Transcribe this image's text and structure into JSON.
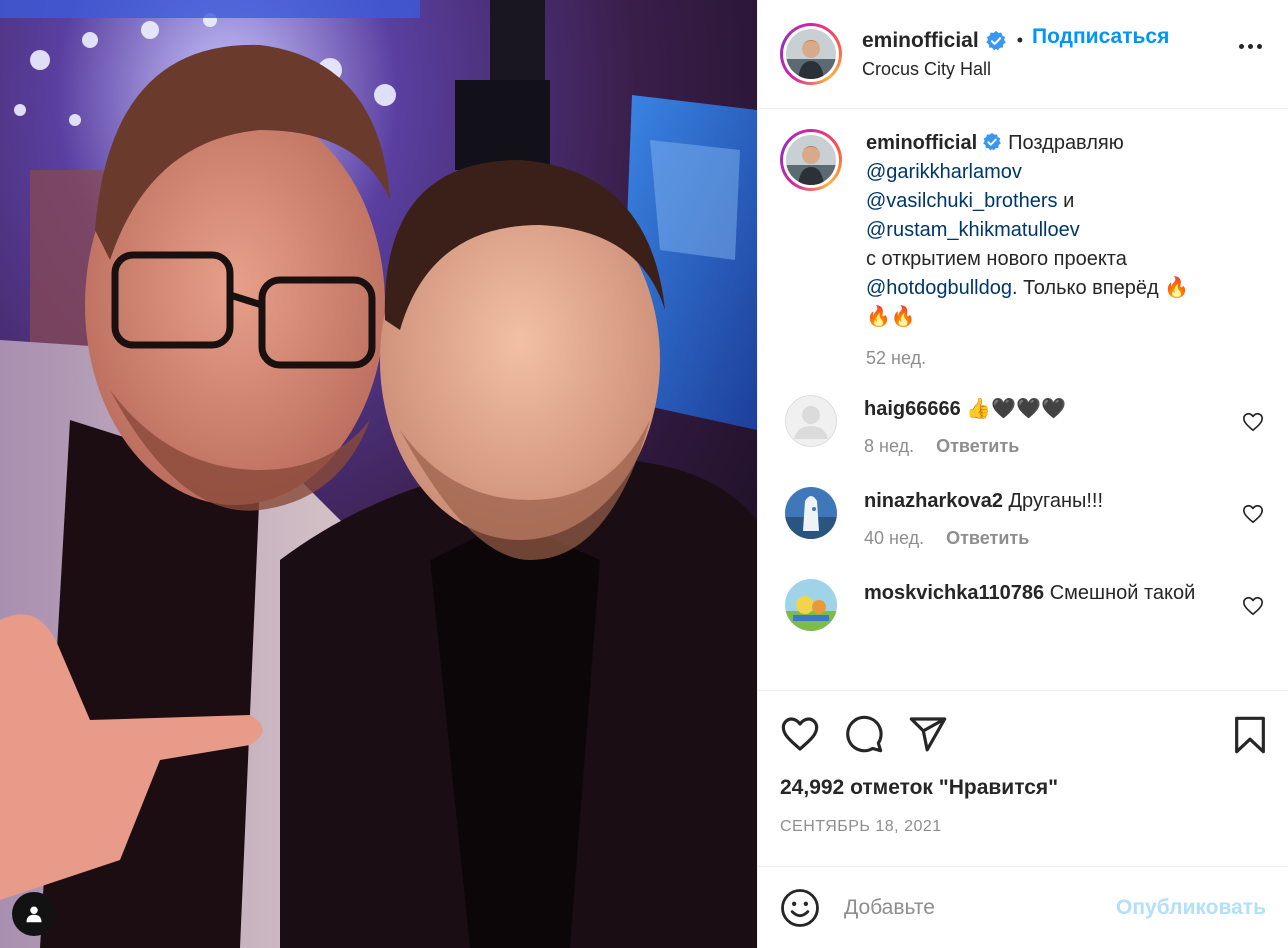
{
  "post": {
    "author": "eminofficial",
    "follow_label": "Подписаться",
    "separator": "•",
    "location": "Crocus City Hall",
    "more_icon": "more-horizontal-icon"
  },
  "caption": {
    "author": "eminofficial",
    "text_start": "Поздравляю",
    "mention1": "@garikkharlamov",
    "mention2": "@vasilchuki_brothers",
    "and": "и",
    "mention3": "@rustam_khikmatulloev",
    "line_project": "с открытием нового проекта",
    "mention4": "@hotdogbulldog",
    "text_end": ". Только вперёд 🔥",
    "emoji_line": "🔥🔥",
    "time": "52 нед."
  },
  "comments": [
    {
      "user": "haig66666",
      "text": "👍🖤🖤🖤",
      "time": "8 нед.",
      "reply": "Ответить"
    },
    {
      "user": "ninazharkova2",
      "text": "Друганы!!!",
      "time": "40 нед.",
      "reply": "Ответить"
    },
    {
      "user": "moskvichka110786",
      "text": "Смешной такой"
    }
  ],
  "actions": {
    "likes": "24,992 отметок \"Нравится\"",
    "date": "СЕНТЯБРЬ 18, 2021",
    "icons": [
      "heart-icon",
      "comment-icon",
      "share-icon",
      "bookmark-icon"
    ]
  },
  "composer": {
    "placeholder": "Добавьте",
    "publish": "Опубликовать"
  },
  "colors": {
    "accent": "#0095f6",
    "mention": "#00376b",
    "muted": "#8e8e8e",
    "publish_disabled": "#b2dffc"
  }
}
